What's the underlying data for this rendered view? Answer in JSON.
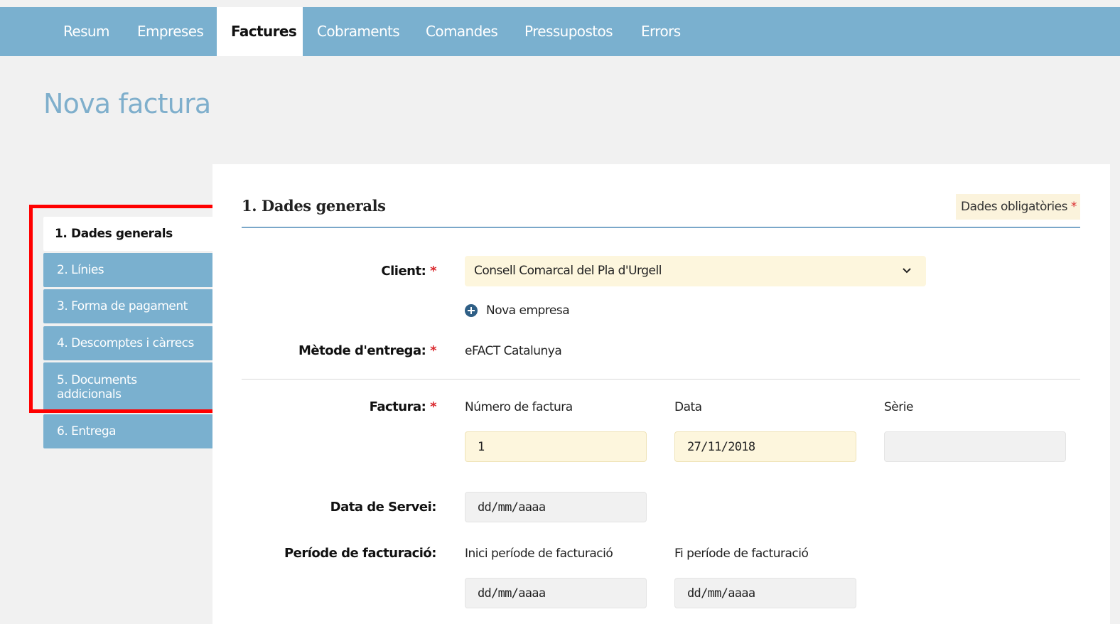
{
  "nav": {
    "tabs": [
      {
        "label": "Resum"
      },
      {
        "label": "Empreses"
      },
      {
        "label": "Factures",
        "active": true
      },
      {
        "label": "Cobraments"
      },
      {
        "label": "Comandes"
      },
      {
        "label": "Pressupostos"
      },
      {
        "label": "Errors"
      }
    ]
  },
  "page": {
    "title": "Nova factura"
  },
  "sidebar": {
    "items": [
      {
        "label": "1. Dades generals",
        "active": true
      },
      {
        "label": "2. Línies"
      },
      {
        "label": "3. Forma de pagament"
      },
      {
        "label": "4. Descomptes i càrrecs"
      },
      {
        "label": "5. Documents addicionals"
      },
      {
        "label": "6. Entrega"
      }
    ]
  },
  "form": {
    "section_title": "1. Dades generals",
    "mandatory_label": "Dades obligatòries",
    "required_mark": "*",
    "client": {
      "label": "Client:",
      "value": "Consell Comarcal del Pla d'Urgell"
    },
    "new_company_link": "Nova empresa",
    "delivery": {
      "label": "Mètode d'entrega:",
      "value": "eFACT Catalunya"
    },
    "invoice": {
      "label": "Factura:",
      "number_label": "Número de factura",
      "number_value": "1",
      "date_label": "Data",
      "date_value": "27/11/2018",
      "series_label": "Sèrie",
      "series_value": ""
    },
    "service_date": {
      "label": "Data de Servei:",
      "placeholder": "dd/mm/aaaa"
    },
    "billing_period": {
      "label": "Període de facturació:",
      "start_label": "Inici període de facturació",
      "start_placeholder": "dd/mm/aaaa",
      "end_label": "Fi període de facturació",
      "end_placeholder": "dd/mm/aaaa"
    }
  },
  "colors": {
    "nav_bg": "#7ab0cf",
    "title": "#7fafcc",
    "required": "#d9262b",
    "input_yellow": "#fdf6dd",
    "highlight": "#ff0000"
  }
}
